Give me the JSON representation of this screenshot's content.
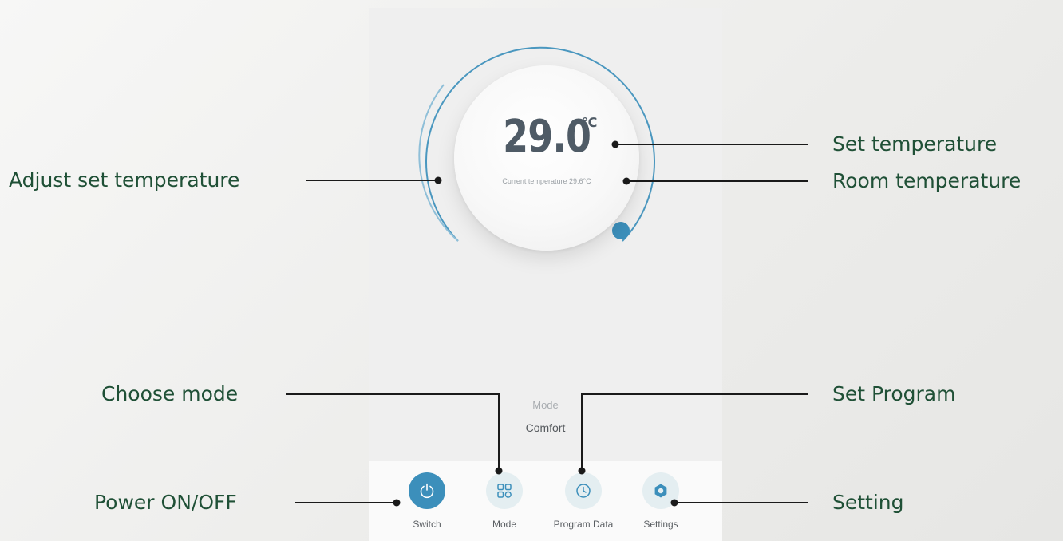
{
  "thermostat": {
    "set_temperature": "29.0",
    "unit": "℃",
    "current_temperature_text": "Current temperature 29.6°C",
    "mode_caption": "Mode",
    "mode_value": "Comfort"
  },
  "tabs": [
    {
      "label": "Switch",
      "icon": "power-icon"
    },
    {
      "label": "Mode",
      "icon": "grid-icon"
    },
    {
      "label": "Program Data",
      "icon": "clock-icon"
    },
    {
      "label": "Settings",
      "icon": "gear-icon"
    }
  ],
  "annotations": {
    "adjust_set_temperature": "Adjust set temperature",
    "set_temperature": "Set temperature",
    "room_temperature": "Room temperature",
    "choose_mode": "Choose mode",
    "set_program": "Set Program",
    "power_on_off": "Power ON/OFF",
    "setting": "Setting"
  },
  "colors": {
    "accent": "#3c8fbb",
    "annotation_text": "#1f5036",
    "callout_line": "#1a1a1a"
  }
}
